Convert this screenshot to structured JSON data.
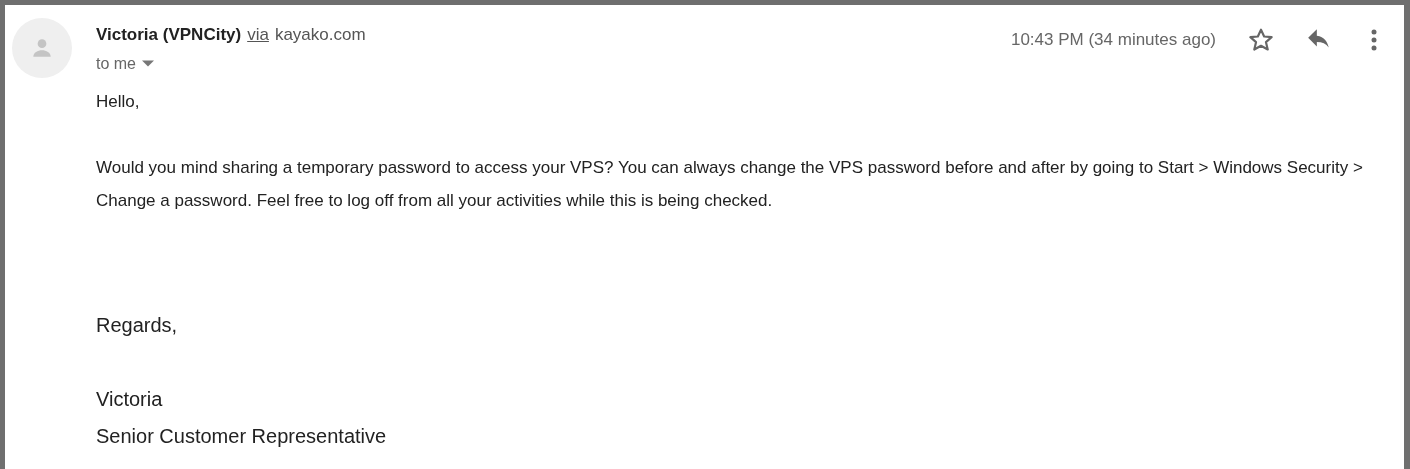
{
  "sender": {
    "name": "Victoria (VPNCity)",
    "via": "via",
    "domain": "kayako.com"
  },
  "recipient": "to me",
  "timestamp": "10:43 PM (34 minutes ago)",
  "starred": false,
  "greeting": "Hello,",
  "body": "Would you mind sharing a temporary password to access your VPS? You can always change the VPS password before and after by going to Start > Windows Security > Change a password. Feel free to log off from all your activities while this is being checked.",
  "closing": "Regards,",
  "signature": [
    "Victoria",
    "Senior Customer Representative"
  ]
}
